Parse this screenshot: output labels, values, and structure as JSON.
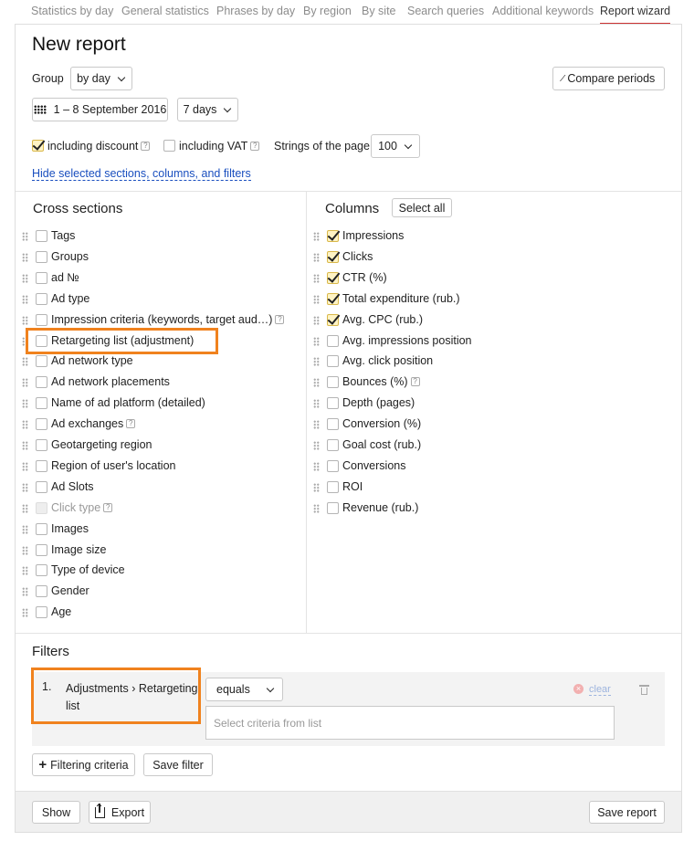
{
  "tabs": [
    "Statistics by day",
    "General statistics",
    "Phrases by day",
    "By region",
    "By site",
    "Search queries",
    "Additional keywords",
    "Report wizard"
  ],
  "header": {
    "title": "New report"
  },
  "group": {
    "label": "Group",
    "value": "by day"
  },
  "compare": {
    "label": "Compare periods"
  },
  "date": {
    "range": "1 – 8 September 2016",
    "period": "7 days"
  },
  "options": {
    "discount": "including discount",
    "vat": "including VAT",
    "strings_label": "Strings of the page",
    "strings_value": "100"
  },
  "hide_link": "Hide selected sections, columns, and filters",
  "cross": {
    "title": "Cross sections",
    "items": [
      {
        "label": "Tags",
        "checked": false
      },
      {
        "label": "Groups",
        "checked": false
      },
      {
        "label": "ad №",
        "checked": false
      },
      {
        "label": "Ad type",
        "checked": false
      },
      {
        "label": "Impression criteria (keywords, target aud…)",
        "checked": false,
        "help": true
      },
      {
        "label": "Retargeting list (adjustment)",
        "checked": false
      },
      {
        "label": "Ad network type",
        "checked": false
      },
      {
        "label": "Ad network placements",
        "checked": false
      },
      {
        "label": "Name of ad platform (detailed)",
        "checked": false
      },
      {
        "label": "Ad exchanges",
        "checked": false,
        "help": true
      },
      {
        "label": "Geotargeting region",
        "checked": false
      },
      {
        "label": "Region of user's location",
        "checked": false
      },
      {
        "label": "Ad Slots",
        "checked": false
      },
      {
        "label": "Click type",
        "checked": false,
        "disabled": true,
        "help": true
      },
      {
        "label": "Images",
        "checked": false
      },
      {
        "label": "Image size",
        "checked": false
      },
      {
        "label": "Type of device",
        "checked": false
      },
      {
        "label": "Gender",
        "checked": false
      },
      {
        "label": "Age",
        "checked": false
      }
    ]
  },
  "columns": {
    "title": "Columns",
    "select_all": "Select all",
    "items": [
      {
        "label": "Impressions",
        "checked": true
      },
      {
        "label": "Clicks",
        "checked": true
      },
      {
        "label": "CTR (%)",
        "checked": true
      },
      {
        "label": "Total expenditure (rub.)",
        "checked": true
      },
      {
        "label": "Avg. CPC (rub.)",
        "checked": true
      },
      {
        "label": "Avg. impressions position",
        "checked": false
      },
      {
        "label": "Avg. click position",
        "checked": false
      },
      {
        "label": "Bounces (%)",
        "checked": false,
        "help": true
      },
      {
        "label": "Depth (pages)",
        "checked": false
      },
      {
        "label": "Conversion (%)",
        "checked": false
      },
      {
        "label": "Goal cost (rub.)",
        "checked": false
      },
      {
        "label": "Conversions",
        "checked": false
      },
      {
        "label": "ROI",
        "checked": false
      },
      {
        "label": "Revenue (rub.)",
        "checked": false
      }
    ]
  },
  "filters": {
    "title": "Filters",
    "number": "1.",
    "name_line1": "Adjustments › Retargeting",
    "name_line2": "list",
    "op": "equals",
    "clear": "clear",
    "placeholder": "Select criteria from list",
    "add_label": "Filtering criteria",
    "save_filter": "Save filter"
  },
  "footer": {
    "show": "Show",
    "export": "Export",
    "save_report": "Save report"
  },
  "colors": {
    "highlight": "#f0821e",
    "link": "#1a4fbf",
    "check_fill": "#fff3c4"
  }
}
